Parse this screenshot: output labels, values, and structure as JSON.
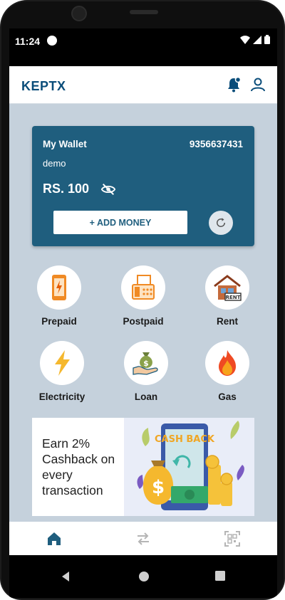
{
  "status_bar": {
    "time": "11:24"
  },
  "header": {
    "brand": "KEPTX",
    "icons": [
      "notification-bell-icon",
      "user-profile-icon"
    ]
  },
  "wallet": {
    "title": "My Wallet",
    "phone": "9356637431",
    "user": "demo",
    "balance": "RS. 100",
    "add_money_label": "+ ADD MONEY"
  },
  "services": [
    {
      "label": "Prepaid",
      "icon": "mobile-recharge-icon"
    },
    {
      "label": "Postpaid",
      "icon": "fax-machine-icon"
    },
    {
      "label": "Rent",
      "icon": "house-rent-icon"
    },
    {
      "label": "Electricity",
      "icon": "lightning-bolt-icon"
    },
    {
      "label": "Loan",
      "icon": "money-bag-hand-icon"
    },
    {
      "label": "Gas",
      "icon": "flame-icon"
    }
  ],
  "promo": {
    "text": "Earn 2% Cashback on every transaction",
    "art_label": "CASH BACK"
  },
  "bottom_nav": [
    "home-icon",
    "transfer-arrows-icon",
    "qr-scan-icon"
  ],
  "colors": {
    "brand": "#0a4d7a",
    "wallet_bg": "#1f5e7e",
    "app_bg": "#c5d1dc"
  }
}
